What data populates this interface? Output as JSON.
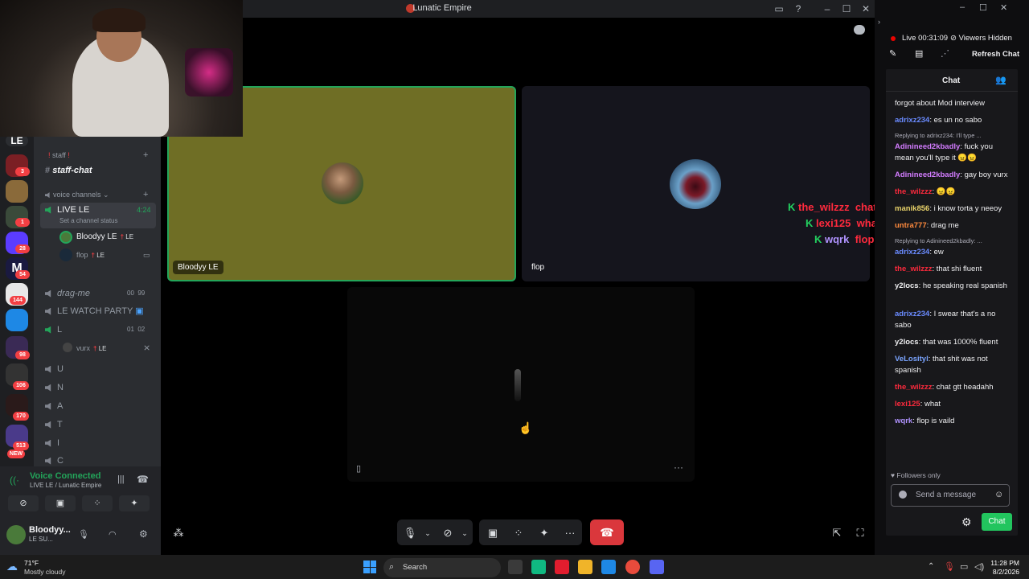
{
  "window": {
    "title": "Lunatic Empire"
  },
  "server_badges": [
    "3",
    "1",
    "28",
    "54",
    "144",
    "98",
    "106",
    "170",
    "513",
    "NEW"
  ],
  "channels": {
    "category_staff": "staff",
    "staff_chat": "staff-chat",
    "voice_header": "voice channels",
    "live_le": "LIVE LE",
    "live_le_time": "4:24",
    "channel_status_placeholder": "Set a channel status",
    "members": [
      {
        "name": "Bloodyy LE",
        "tag": "LE"
      },
      {
        "name": "flop",
        "tag": "LE"
      }
    ],
    "drag_me": "drag-me",
    "drag_me_counts": [
      "00",
      "99"
    ],
    "watch_party": "LE WATCH PARTY",
    "l_channel": "L",
    "l_counts": [
      "01",
      "02"
    ],
    "l_member": {
      "name": "vurx",
      "tag": "LE"
    },
    "letters": [
      "U",
      "N",
      "A",
      "T",
      "I",
      "C"
    ]
  },
  "voice_panel": {
    "status": "Voice Connected",
    "location": "LIVE LE / Lunatic Empire",
    "username": "Bloodyy...",
    "substatus": "LE SU..."
  },
  "tiles": [
    {
      "name": "Bloodyy LE"
    },
    {
      "name": "flop"
    }
  ],
  "overlay_chat": [
    {
      "user": "the_wilzzz",
      "text": "chat gtt headahh",
      "color": "#ff2a3d"
    },
    {
      "user": "lexi125",
      "text": "what",
      "color": "#ff2a3d"
    },
    {
      "user": "wqrk",
      "text": "flop is vaild",
      "color": "#b093ff"
    }
  ],
  "stream_panel": {
    "live_label": "Live",
    "live_time": "00:31:09",
    "viewers": "Viewers Hidden",
    "refresh": "Refresh Chat",
    "chat_tab": "Chat",
    "followers_only": "Followers only",
    "send_placeholder": "Send a message",
    "chat_button": "Chat",
    "messages": [
      {
        "user": "",
        "text": "forgot about Mod interview",
        "color": "#efeff1"
      },
      {
        "user": "adrixz234",
        "text": "es un no sabo",
        "color": "#6a8bff"
      },
      {
        "reply": "Replying to adrixz234: I'll type ..."
      },
      {
        "user": "Adinineed2kbadly",
        "text": "fuck you mean you'll type it 😠😠",
        "color": "#d37cff"
      },
      {
        "user": "Adinineed2kbadly",
        "text": "gay boy vurx",
        "color": "#d37cff"
      },
      {
        "user": "the_wilzzz",
        "text": "😠😠",
        "color": "#ff2a3d"
      },
      {
        "user": "manik856",
        "text": "i know torta y neeoy",
        "color": "#e8d26a"
      },
      {
        "user": "untra777",
        "text": "drag me",
        "color": "#ff8a3d"
      },
      {
        "reply": "Replying to Adinineed2kbadly: ..."
      },
      {
        "user": "adrixz234",
        "text": "ew",
        "color": "#6a8bff"
      },
      {
        "user": "the_wilzzz",
        "text": "that shi fluent",
        "color": "#ff2a3d"
      },
      {
        "user": "y2locs",
        "text": "he speaking real spanish",
        "color": "#efeff1"
      },
      {
        "user": "adrixz234",
        "text": "I swear that's a no sabo",
        "color": "#6a8bff"
      },
      {
        "user": "y2locs",
        "text": "that was 1000% fluent",
        "color": "#efeff1"
      },
      {
        "user": "VeLosityl",
        "text": "that shit was not spanish",
        "color": "#7aa4ff"
      },
      {
        "user": "the_wilzzz",
        "text": "chat gtt headahh",
        "color": "#ff2a3d"
      },
      {
        "user": "lexi125",
        "text": "what",
        "color": "#ff2a3d"
      },
      {
        "user": "wqrk",
        "text": "flop is vaild",
        "color": "#b093ff"
      }
    ]
  },
  "taskbar": {
    "weather_temp": "71°F",
    "weather_desc": "Mostly cloudy",
    "search": "Search",
    "time": "11:28 PM",
    "date": "8/2/2026"
  }
}
